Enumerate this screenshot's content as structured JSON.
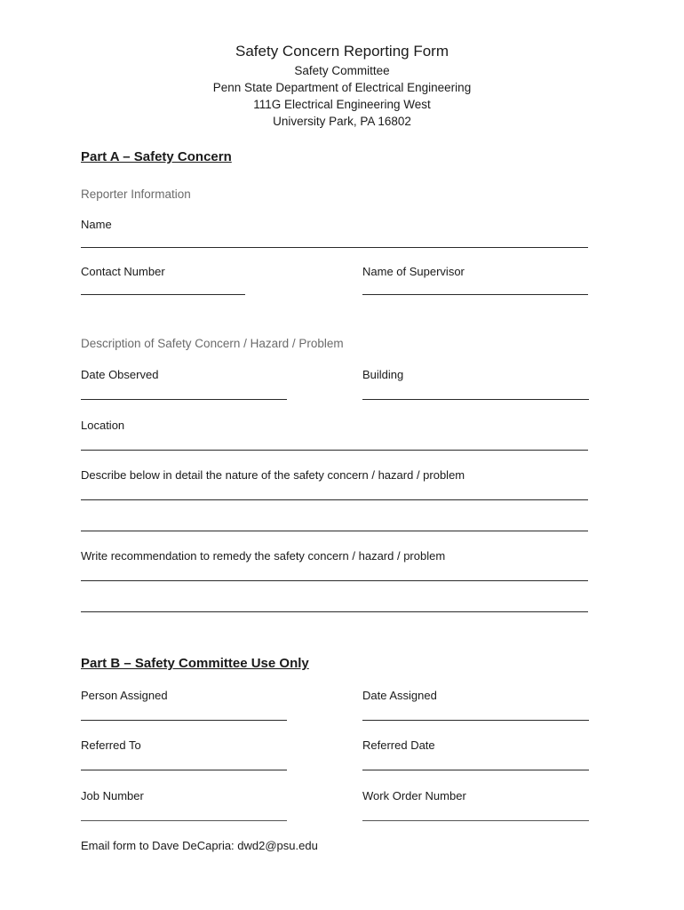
{
  "header": {
    "title": "Safety Concern Reporting Form",
    "lines": [
      "Safety Committee",
      "Penn State Department of Electrical Engineering",
      "111G Electrical Engineering West",
      "University Park, PA 16802"
    ]
  },
  "part_a": {
    "heading": "Part A – Safety Concern",
    "reporter": {
      "subheading": "Reporter Information",
      "name_label": "Name",
      "contact_label": "Contact Number",
      "supervisor_label": "Name of Supervisor"
    },
    "description": {
      "subheading": "Description of Safety Concern / Hazard / Problem",
      "date_observed_label": "Date Observed",
      "building_label": "Building",
      "location_label": "Location",
      "detail_label": "Describe below in detail the nature of the safety concern / hazard / problem",
      "recommendation_label": "Write recommendation to remedy the safety concern / hazard / problem"
    }
  },
  "part_b": {
    "heading": "Part B – Safety Committee Use Only",
    "person_assigned_label": "Person Assigned",
    "date_assigned_label": "Date Assigned",
    "referred_to_label": "Referred To",
    "referred_date_label": "Referred Date",
    "job_number_label": "Job Number",
    "work_order_label": "Work Order Number"
  },
  "footer": {
    "email_text": "Email form to Dave DeCapria: dwd2@psu.edu"
  }
}
